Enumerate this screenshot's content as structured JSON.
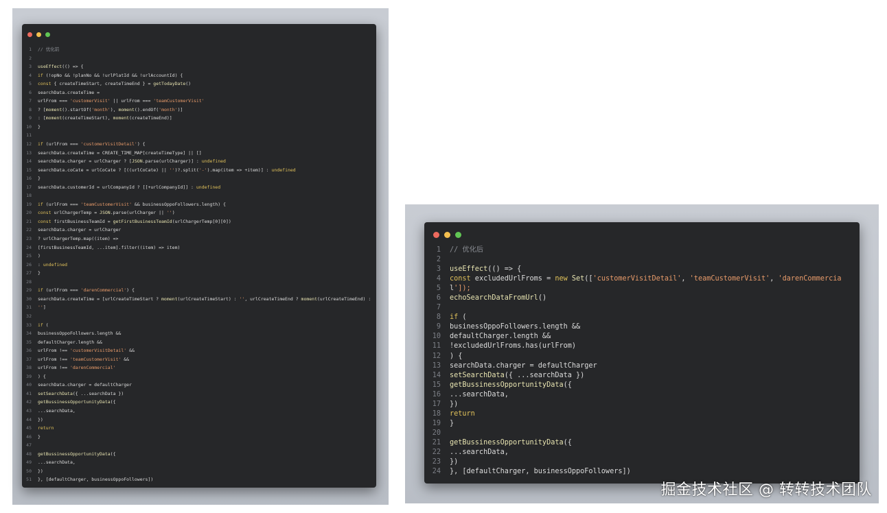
{
  "colors": {
    "red": "#ed6a5e",
    "yellow": "#f4bf4f",
    "green": "#61c554",
    "window_bg": "#262729",
    "backdrop": "#c0c4cb"
  },
  "left_window": {
    "lines": [
      {
        "n": "1",
        "t": "// 优化前",
        "c": "cm"
      },
      {
        "n": "2",
        "t": ""
      },
      {
        "n": "3",
        "t": "useEffect(() => {"
      },
      {
        "n": "4",
        "t": "if (!opNo && !planNo && !urlPlatId && !urlAccountId) {"
      },
      {
        "n": "5",
        "t": "const { createTimeStart, createTimeEnd } = getTodayDate()"
      },
      {
        "n": "6",
        "t": "searchData.createTime ="
      },
      {
        "n": "7",
        "t": "urlFrom === 'customerVisit' || urlFrom === 'teamCustomerVisit'"
      },
      {
        "n": "8",
        "t": "? [moment().startOf('month'), moment().endOf('month')]"
      },
      {
        "n": "9",
        "t": ": [moment(createTimeStart), moment(createTimeEnd)]"
      },
      {
        "n": "10",
        "t": "}"
      },
      {
        "n": "11",
        "t": ""
      },
      {
        "n": "12",
        "t": "if (urlFrom === 'customerVisitDetail') {"
      },
      {
        "n": "13",
        "t": "searchData.createTime = CREATE_TIME_MAP[createTimeType] || []"
      },
      {
        "n": "14",
        "t": "searchData.charger = urlCharger ? [JSON.parse(urlCharger)] : undefined"
      },
      {
        "n": "15",
        "t": "searchData.coCate = urlCoCate ? [((urlCoCate) || '')?.split('-').map(item => +item)] : undefined"
      },
      {
        "n": "16",
        "t": "}"
      },
      {
        "n": "17",
        "t": "searchData.customerId = urlCompanyId ? [[+urlCompanyId]] : undefined"
      },
      {
        "n": "18",
        "t": ""
      },
      {
        "n": "19",
        "t": "if (urlFrom === 'teamCustomerVisit' && businessOppoFollowers.length) {"
      },
      {
        "n": "20",
        "t": "const urlChargerTemp = JSON.parse(urlCharger || '')"
      },
      {
        "n": "21",
        "t": "const firstBusinessTeamId = getFirstBusinessTeamId(urlChargerTemp[0][0])"
      },
      {
        "n": "22",
        "t": "searchData.charger = urlCharger"
      },
      {
        "n": "23",
        "t": "? urlChargerTemp.map((item) =>"
      },
      {
        "n": "24",
        "t": "[firstBusinessTeamId, ...item].filter((item) => item)"
      },
      {
        "n": "25",
        "t": ")"
      },
      {
        "n": "26",
        "t": ": undefined"
      },
      {
        "n": "27",
        "t": "}"
      },
      {
        "n": "28",
        "t": ""
      },
      {
        "n": "29",
        "t": "if (urlFrom === 'darenCommercial') {"
      },
      {
        "n": "30",
        "t": "searchData.createTime = [urlCreateTimeStart ? moment(urlCreateTimeStart) : '', urlCreateTimeEnd ? moment(urlCreateTimeEnd) :"
      },
      {
        "n": "31",
        "t": "'']"
      },
      {
        "n": "32",
        "t": ""
      },
      {
        "n": "33",
        "t": "if ("
      },
      {
        "n": "34",
        "t": "businessOppoFollowers.length &&"
      },
      {
        "n": "35",
        "t": "defaultCharger.length &&"
      },
      {
        "n": "36",
        "t": "urlFrom !== 'customerVisitDetail' &&"
      },
      {
        "n": "37",
        "t": "urlFrom !== 'teamCustomerVisit' &&"
      },
      {
        "n": "38",
        "t": "urlFrom !== 'darenCommercial'"
      },
      {
        "n": "39",
        "t": ") {"
      },
      {
        "n": "40",
        "t": "searchData.charger = defaultCharger"
      },
      {
        "n": "41",
        "t": "setSearchData({ ...searchData })"
      },
      {
        "n": "42",
        "t": "getBussinessOpportunityData({"
      },
      {
        "n": "43",
        "t": "...searchData,"
      },
      {
        "n": "44",
        "t": "})"
      },
      {
        "n": "45",
        "t": "return"
      },
      {
        "n": "46",
        "t": "}"
      },
      {
        "n": "47",
        "t": ""
      },
      {
        "n": "48",
        "t": "getBussinessOpportunityData({"
      },
      {
        "n": "49",
        "t": "...searchData,"
      },
      {
        "n": "50",
        "t": "})"
      },
      {
        "n": "51",
        "t": "}, [defaultCharger, businessOppoFollowers])"
      }
    ]
  },
  "right_window": {
    "lines": [
      {
        "n": "1",
        "t": "// 优化后",
        "c": "cm"
      },
      {
        "n": "2",
        "t": ""
      },
      {
        "n": "3",
        "t": "useEffect(() => {"
      },
      {
        "n": "4",
        "t": "const excludedUrlFroms = new Set(['customerVisitDetail', 'teamCustomerVisit', 'darenCommercia"
      },
      {
        "n": "5",
        "t": "l']);"
      },
      {
        "n": "6",
        "t": "echoSearchDataFromUrl()"
      },
      {
        "n": "7",
        "t": ""
      },
      {
        "n": "8",
        "t": "if ("
      },
      {
        "n": "9",
        "t": "businessOppoFollowers.length &&"
      },
      {
        "n": "10",
        "t": "defaultCharger.length &&"
      },
      {
        "n": "11",
        "t": "!excludedUrlFroms.has(urlFrom)"
      },
      {
        "n": "12",
        "t": ") {"
      },
      {
        "n": "13",
        "t": "searchData.charger = defaultCharger"
      },
      {
        "n": "14",
        "t": "setSearchData({ ...searchData })"
      },
      {
        "n": "15",
        "t": "getBussinessOpportunityData({"
      },
      {
        "n": "16",
        "t": "...searchData,"
      },
      {
        "n": "17",
        "t": "})"
      },
      {
        "n": "18",
        "t": "return"
      },
      {
        "n": "19",
        "t": "}"
      },
      {
        "n": "20",
        "t": ""
      },
      {
        "n": "21",
        "t": "getBussinessOpportunityData({"
      },
      {
        "n": "22",
        "t": "...searchData,"
      },
      {
        "n": "23",
        "t": "})"
      },
      {
        "n": "24",
        "t": "}, [defaultCharger, businessOppoFollowers])"
      }
    ]
  },
  "watermark": "掘金技术社区 @ 转转技术团队"
}
